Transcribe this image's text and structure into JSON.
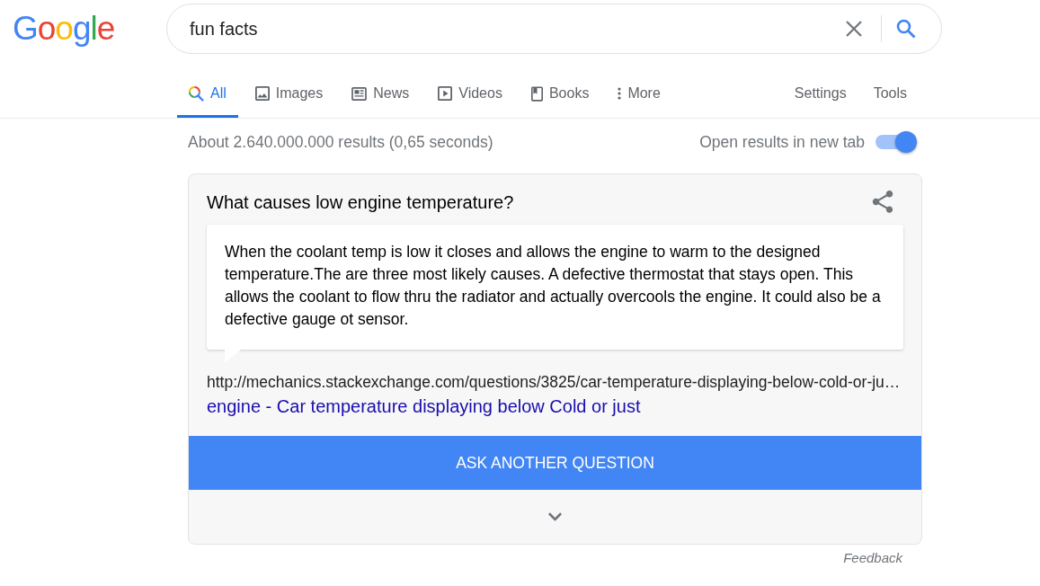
{
  "logo": {
    "text": "Google"
  },
  "search": {
    "value": "fun facts"
  },
  "tabs": [
    {
      "label": "All",
      "selected": true
    },
    {
      "label": "Images",
      "selected": false
    },
    {
      "label": "News",
      "selected": false
    },
    {
      "label": "Videos",
      "selected": false
    },
    {
      "label": "Books",
      "selected": false
    },
    {
      "label": "More",
      "selected": false
    }
  ],
  "menu_links": [
    {
      "label": "Settings"
    },
    {
      "label": "Tools"
    }
  ],
  "result_stats": "About 2.640.000.000 results (0,65 seconds)",
  "new_tab_toggle": {
    "label": "Open results in new tab",
    "on": true
  },
  "question_card": {
    "question": "What causes low engine temperature?",
    "answer": "When the coolant temp is low it closes and allows the engine to warm to the designed temperature.The are three most likely causes. A defective thermostat that stays open. This allows the coolant to flow thru the radiator and actually overcools the engine. It could also be a defective gauge ot sensor.",
    "source_url": "http://mechanics.stackexchange.com/questions/3825/car-temperature-displaying-below-cold-or-ju…",
    "source_title": "engine - Car temperature displaying below Cold or just",
    "button": "ASK ANOTHER QUESTION",
    "expanded": false
  },
  "feedback": "Feedback"
}
